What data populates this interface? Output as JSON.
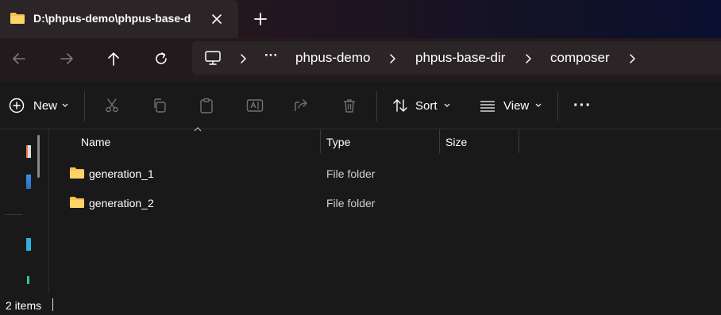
{
  "tab": {
    "title": "D:\\phpus-demo\\phpus-base-d"
  },
  "breadcrumb": [
    "phpus-demo",
    "phpus-base-dir",
    "composer"
  ],
  "breadcrumb_overflow": "···",
  "command_bar": {
    "new_label": "New",
    "sort_label": "Sort",
    "view_label": "View",
    "more_label": "···"
  },
  "columns": {
    "name": "Name",
    "type": "Type",
    "size": "Size"
  },
  "files": [
    {
      "name": "generation_1",
      "type": "File folder",
      "size": ""
    },
    {
      "name": "generation_2",
      "type": "File folder",
      "size": ""
    }
  ],
  "status": {
    "item_count": "2 items"
  },
  "colors": {
    "folder": "#f5c24b",
    "background": "#191919",
    "address_bar": "#2c2528"
  }
}
